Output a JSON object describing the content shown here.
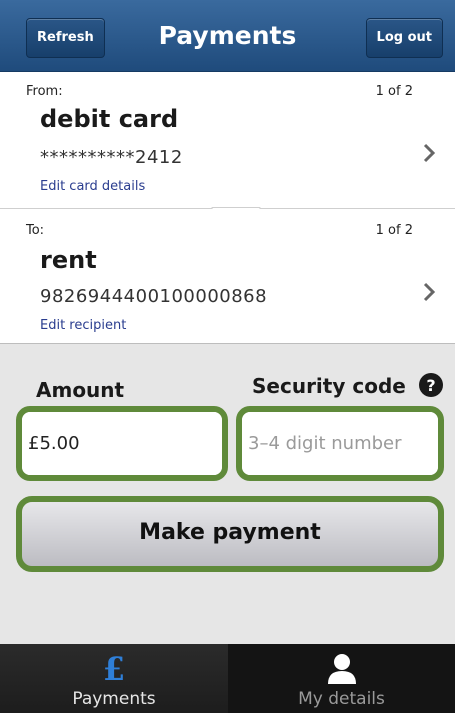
{
  "header": {
    "title": "Payments",
    "refresh_label": "Refresh",
    "logout_label": "Log out"
  },
  "from": {
    "label": "From:",
    "count": "1 of 2",
    "name": "debit card",
    "number": "**********2412",
    "link": "Edit card details"
  },
  "to": {
    "label": "To:",
    "count": "1 of 2",
    "name": "rent",
    "number": "9826944400100000868",
    "link": "Edit recipient"
  },
  "form": {
    "amount_label": "Amount",
    "amount_value": "£5.00",
    "security_label": "Security code",
    "security_placeholder": "3–4 digit number",
    "pay_label": "Make payment"
  },
  "tabs": [
    {
      "label": "Payments",
      "icon": "pound-icon",
      "active": true
    },
    {
      "label": "My details",
      "icon": "person-icon",
      "active": false
    }
  ],
  "colors": {
    "header": "#1f4b7c",
    "field_border": "#5f8a3a",
    "link": "#2a3d8f",
    "tabbar": "#141414"
  }
}
